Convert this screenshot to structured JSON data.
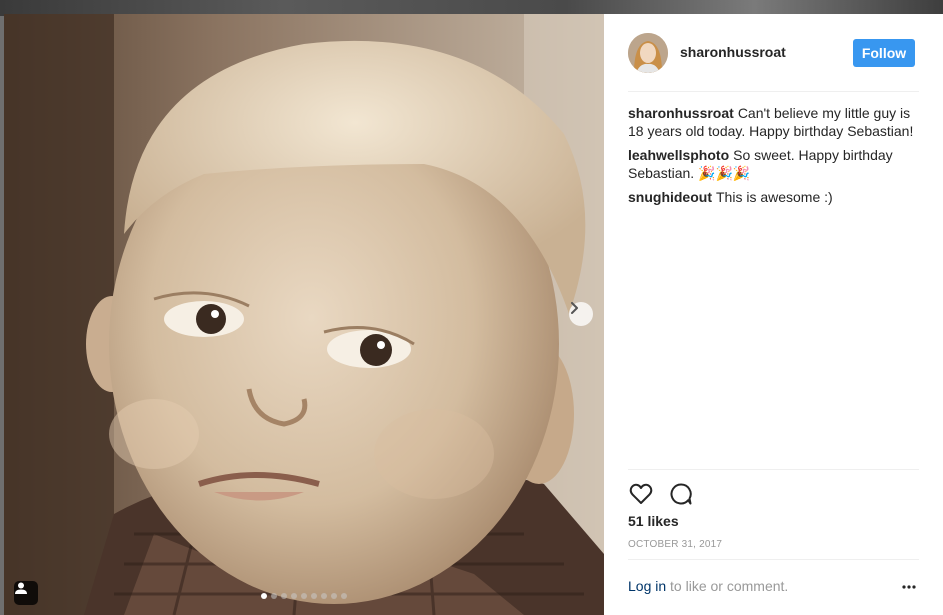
{
  "post": {
    "username": "sharonhussroat",
    "follow_label": "Follow",
    "comments": [
      {
        "user": "sharonhussroat",
        "text": "Can't believe my little guy is 18 years old today. Happy birthday Sebastian!"
      },
      {
        "user": "leahwellsphoto",
        "text": "So sweet. Happy birthday Sebastian. 🎉🎉🎉"
      },
      {
        "user": "snughideout",
        "text": "This is awesome :)"
      }
    ],
    "likes": "51 likes",
    "date": "OCTOBER 31, 2017",
    "login_link": "Log in",
    "login_rest": " to like or comment."
  },
  "carousel": {
    "total": 9,
    "active_index": 0
  },
  "icons": {
    "like": "heart-icon",
    "comment": "speech-bubble-icon",
    "more": "ellipsis-icon",
    "next": "chevron-right-icon",
    "tag": "person-icon"
  },
  "colors": {
    "follow": "#3897f0",
    "link": "#003569",
    "muted": "#999999",
    "text": "#262626"
  }
}
